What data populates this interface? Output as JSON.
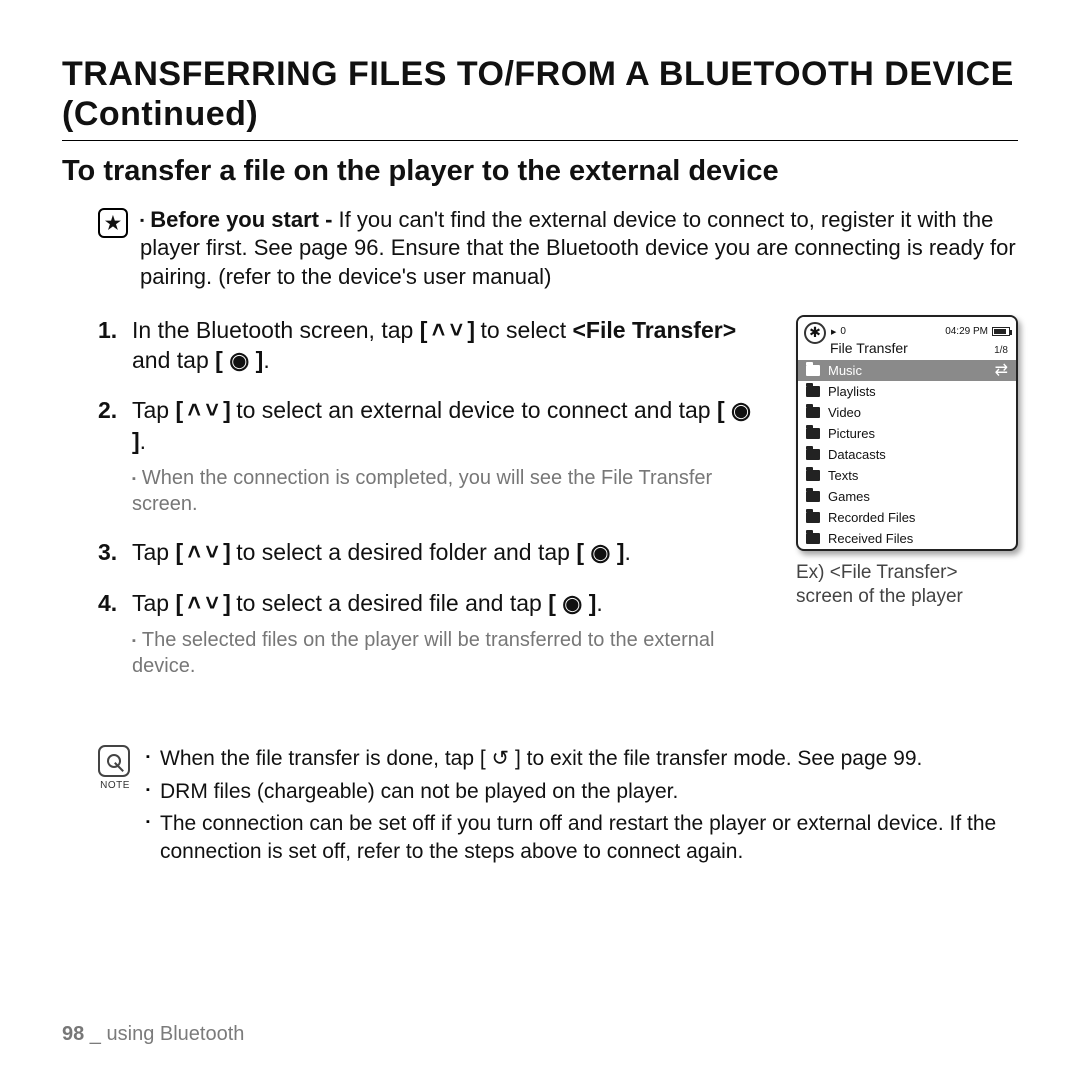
{
  "title": "TRANSFERRING FILES TO/FROM A BLUETOOTH DEVICE (Continued)",
  "subtitle": "To transfer a file on the player to the external device",
  "tip": {
    "lead": "Before you start -",
    "body": " If you can't find the external device to connect to, register it with the player first. See page 96. Ensure that the Bluetooth device you are connecting is ready for pairing. (refer to the device's user manual)"
  },
  "glyphs": {
    "updown": "[ ˄ ˅ ]",
    "ok": "[ ◉ ]",
    "back": "[ ↺ ]"
  },
  "steps": [
    {
      "pre1": "In the Bluetooth screen, tap ",
      "mid1": " to select ",
      "bold": "<File Transfer>",
      "mid2": " and tap ",
      "post": "."
    },
    {
      "pre1": "Tap ",
      "mid1": " to select an external device to connect and tap ",
      "post": ".",
      "sub": "When the connection is completed, you will see the File Transfer screen."
    },
    {
      "pre1": "Tap ",
      "mid1": " to select a desired folder and tap ",
      "post": "."
    },
    {
      "pre1": "Tap ",
      "mid1": " to select a desired file and tap ",
      "post": ".",
      "sub": "The selected files on the player will be transferred to the external device."
    }
  ],
  "device": {
    "stop": "0",
    "time": "04:29 PM",
    "screen_title": "File Transfer",
    "count": "1/8",
    "items": [
      "Music",
      "Playlists",
      "Video",
      "Pictures",
      "Datacasts",
      "Texts",
      "Games",
      "Recorded Files",
      "Received Files"
    ],
    "selected": 0
  },
  "caption": "Ex) <File Transfer> screen of the player",
  "notes": [
    {
      "a": "When the file transfer is done, tap ",
      "b": " to exit the file transfer mode. See page 99."
    },
    {
      "a": "DRM files (chargeable) can not be played on the player."
    },
    {
      "a": "The connection can be set off if you turn off and restart the player or external device. If the connection is set off, refer to the steps above to connect again."
    }
  ],
  "note_label": "NOTE",
  "footer": {
    "page": "98",
    "sep": " _ ",
    "section": "using Bluetooth"
  }
}
